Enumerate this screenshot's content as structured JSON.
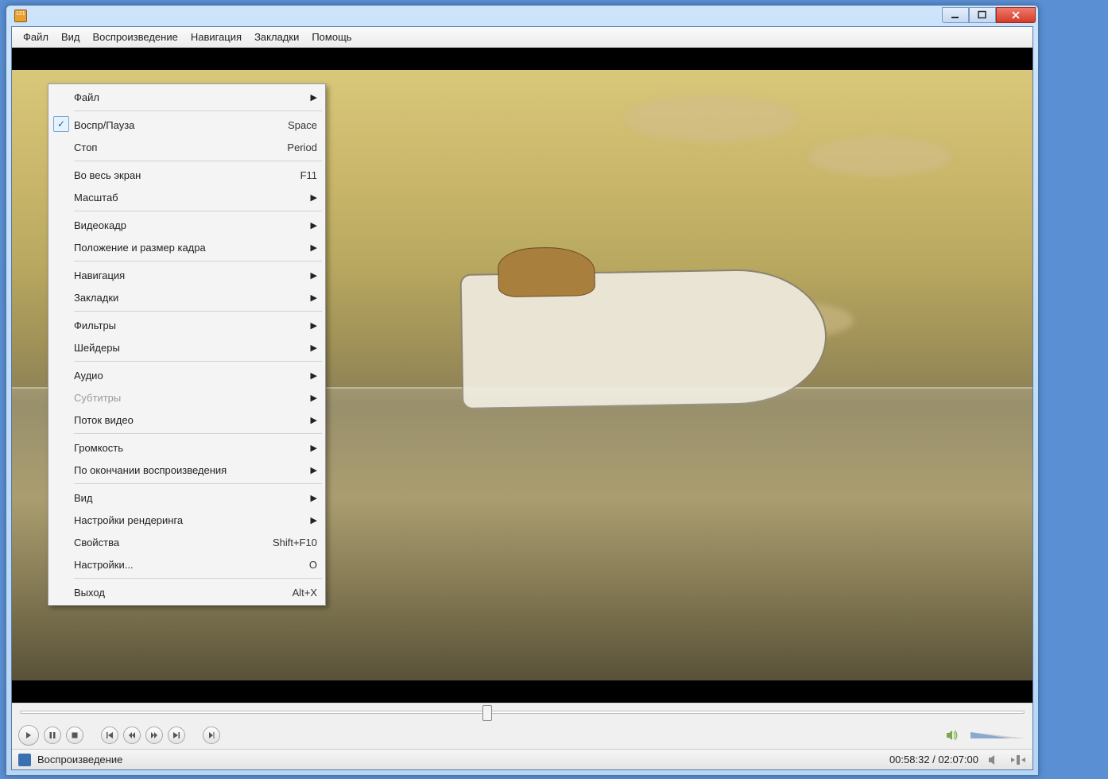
{
  "menubar": {
    "items": [
      "Файл",
      "Вид",
      "Воспроизведение",
      "Навигация",
      "Закладки",
      "Помощь"
    ]
  },
  "context_menu": [
    {
      "type": "item",
      "label": "Файл",
      "submenu": true
    },
    {
      "type": "sep"
    },
    {
      "type": "item",
      "label": "Воспр/Пауза",
      "shortcut": "Space",
      "checked": true
    },
    {
      "type": "item",
      "label": "Стоп",
      "shortcut": "Period"
    },
    {
      "type": "sep"
    },
    {
      "type": "item",
      "label": "Во весь экран",
      "shortcut": "F11"
    },
    {
      "type": "item",
      "label": "Масштаб",
      "submenu": true
    },
    {
      "type": "sep"
    },
    {
      "type": "item",
      "label": "Видеокадр",
      "submenu": true
    },
    {
      "type": "item",
      "label": "Положение и размер кадра",
      "submenu": true
    },
    {
      "type": "sep"
    },
    {
      "type": "item",
      "label": "Навигация",
      "submenu": true
    },
    {
      "type": "item",
      "label": "Закладки",
      "submenu": true
    },
    {
      "type": "sep"
    },
    {
      "type": "item",
      "label": "Фильтры",
      "submenu": true
    },
    {
      "type": "item",
      "label": "Шейдеры",
      "submenu": true
    },
    {
      "type": "sep"
    },
    {
      "type": "item",
      "label": "Аудио",
      "submenu": true
    },
    {
      "type": "item",
      "label": "Субтитры",
      "submenu": true,
      "disabled": true
    },
    {
      "type": "item",
      "label": "Поток видео",
      "submenu": true
    },
    {
      "type": "sep"
    },
    {
      "type": "item",
      "label": "Громкость",
      "submenu": true
    },
    {
      "type": "item",
      "label": "По окончании воспроизведения",
      "submenu": true
    },
    {
      "type": "sep"
    },
    {
      "type": "item",
      "label": "Вид",
      "submenu": true
    },
    {
      "type": "item",
      "label": "Настройки рендеринга",
      "submenu": true
    },
    {
      "type": "item",
      "label": "Свойства",
      "shortcut": "Shift+F10"
    },
    {
      "type": "item",
      "label": "Настройки...",
      "shortcut": "O"
    },
    {
      "type": "sep"
    },
    {
      "type": "item",
      "label": "Выход",
      "shortcut": "Alt+X"
    }
  ],
  "status": {
    "state": "Воспроизведение",
    "time": "00:58:32 / 02:07:00"
  },
  "seek_percent": 46
}
